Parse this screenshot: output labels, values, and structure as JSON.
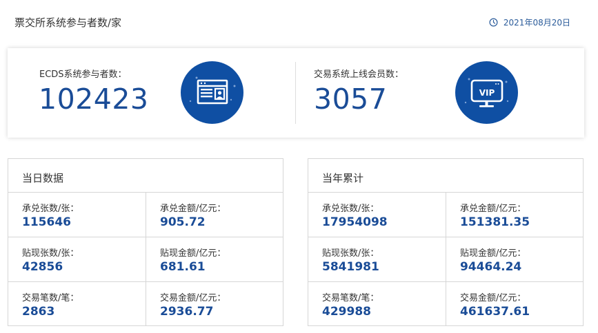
{
  "header": {
    "title": "票交所系统参与者数/家",
    "date": "2021年08月20日"
  },
  "summary": {
    "ecds": {
      "label": "ECDS系统参与者数：",
      "value": "102423"
    },
    "members": {
      "label": "交易系统上线会员数：",
      "value": "3057"
    },
    "vip_text": "VIP"
  },
  "daily": {
    "title": "当日数据",
    "cells": [
      {
        "label": "承兑张数/张：",
        "value": "115646"
      },
      {
        "label": "承兑金额/亿元：",
        "value": "905.72"
      },
      {
        "label": "贴现张数/张：",
        "value": "42856"
      },
      {
        "label": "贴现金额/亿元：",
        "value": "681.61"
      },
      {
        "label": "交易笔数/笔：",
        "value": "2863"
      },
      {
        "label": "交易金额/亿元：",
        "value": "2936.77"
      }
    ]
  },
  "yearly": {
    "title": "当年累计",
    "cells": [
      {
        "label": "承兑张数/张：",
        "value": "17954098"
      },
      {
        "label": "承兑金额/亿元：",
        "value": "151381.35"
      },
      {
        "label": "贴现张数/张：",
        "value": "5841981"
      },
      {
        "label": "贴现金额/亿元：",
        "value": "94464.24"
      },
      {
        "label": "交易笔数/笔：",
        "value": "429988"
      },
      {
        "label": "交易金额/亿元：",
        "value": "461637.61"
      }
    ]
  },
  "colors": {
    "accent": "#1a4c97",
    "icon_bg": "#0f4fa3",
    "border": "#d6d6d6"
  },
  "icons": [
    "clock-icon",
    "browser-profile-icon",
    "vip-monitor-icon"
  ]
}
